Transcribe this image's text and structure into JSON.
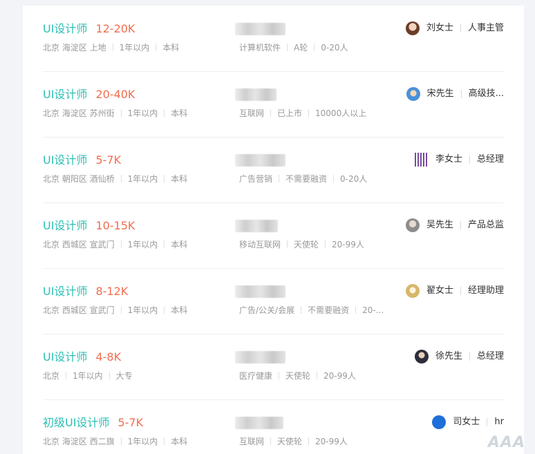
{
  "jobs": [
    {
      "title": "UI设计师",
      "salary": "12-20K",
      "location": "北京 海淀区 上地",
      "experience": "1年以内",
      "education": "本科",
      "industry": "计算机软件",
      "stage": "A轮",
      "size": "0-20人",
      "recruiter": "刘女士",
      "role": "人事主管",
      "avatar_color": "#c98b6b"
    },
    {
      "title": "UI设计师",
      "salary": "20-40K",
      "location": "北京 海淀区 苏州街",
      "experience": "1年以内",
      "education": "本科",
      "industry": "互联网",
      "stage": "已上市",
      "size": "10000人以上",
      "recruiter": "宋先生",
      "role": "高级技...",
      "avatar_color": "#6aa8e8"
    },
    {
      "title": "UI设计师",
      "salary": "5-7K",
      "location": "北京 朝阳区 酒仙桥",
      "experience": "1年以内",
      "education": "本科",
      "industry": "广告营销",
      "stage": "不需要融资",
      "size": "0-20人",
      "recruiter": "李女士",
      "role": "总经理",
      "avatar_color": "#7a4aa0"
    },
    {
      "title": "UI设计师",
      "salary": "10-15K",
      "location": "北京 西城区 宣武门",
      "experience": "1年以内",
      "education": "本科",
      "industry": "移动互联网",
      "stage": "天使轮",
      "size": "20-99人",
      "recruiter": "吴先生",
      "role": "产品总监",
      "avatar_color": "#8c8c8c"
    },
    {
      "title": "UI设计师",
      "salary": "8-12K",
      "location": "北京 西城区 宣武门",
      "experience": "1年以内",
      "education": "本科",
      "industry": "广告/公关/会展",
      "stage": "不需要融资",
      "size": "20-...",
      "recruiter": "翟女士",
      "role": "经理助理",
      "avatar_color": "#d8b66a"
    },
    {
      "title": "UI设计师",
      "salary": "4-8K",
      "location": "北京",
      "experience": "1年以内",
      "education": "大专",
      "industry": "医疗健康",
      "stage": "天使轮",
      "size": "20-99人",
      "recruiter": "徐先生",
      "role": "总经理",
      "avatar_color": "#2c2f3a"
    },
    {
      "title": "初级UI设计师",
      "salary": "5-7K",
      "location": "北京 海淀区 西二旗",
      "experience": "1年以内",
      "education": "本科",
      "industry": "互联网",
      "stage": "天使轮",
      "size": "20-99人",
      "recruiter": "司女士",
      "role": "hr",
      "avatar_color": "#1e6fd9"
    }
  ]
}
